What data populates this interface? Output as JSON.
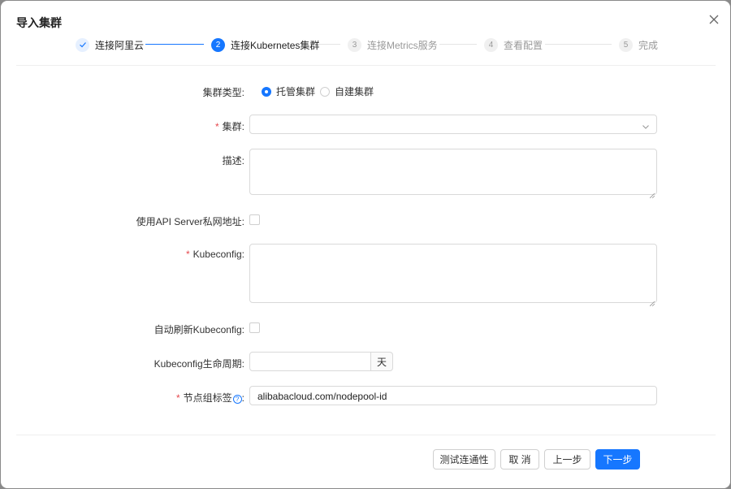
{
  "dialog": {
    "title": "导入集群"
  },
  "steps": [
    {
      "index": "✓",
      "label": "连接阿里云",
      "state": "done"
    },
    {
      "index": "2",
      "label": "连接Kubernetes集群",
      "state": "active"
    },
    {
      "index": "3",
      "label": "连接Metrics服务",
      "state": "wait"
    },
    {
      "index": "4",
      "label": "查看配置",
      "state": "wait"
    },
    {
      "index": "5",
      "label": "完成",
      "state": "wait"
    }
  ],
  "form": {
    "cluster_type": {
      "label": "集群类型",
      "options": [
        "托管集群",
        "自建集群"
      ],
      "selected": "托管集群"
    },
    "cluster": {
      "label": "集群",
      "required": true,
      "value": ""
    },
    "description": {
      "label": "描述",
      "value": ""
    },
    "private_api": {
      "label": "使用API Server私网地址",
      "checked": false
    },
    "kubeconfig": {
      "label": "Kubeconfig",
      "required": true,
      "value": ""
    },
    "auto_refresh": {
      "label": "自动刷新Kubeconfig",
      "checked": false
    },
    "lifetime": {
      "label": "Kubeconfig生命周期",
      "value": "",
      "unit": "天"
    },
    "node_label": {
      "label": "节点组标签",
      "required": true,
      "help": "?",
      "value": "alibabacloud.com/nodepool-id"
    },
    "colon": ":"
  },
  "footer": {
    "test_label": "测试连通性",
    "cancel_label": "取 消",
    "prev_label": "上一步",
    "next_label": "下一步"
  },
  "colors": {
    "primary": "#1677ff",
    "required": "#e5484d"
  }
}
